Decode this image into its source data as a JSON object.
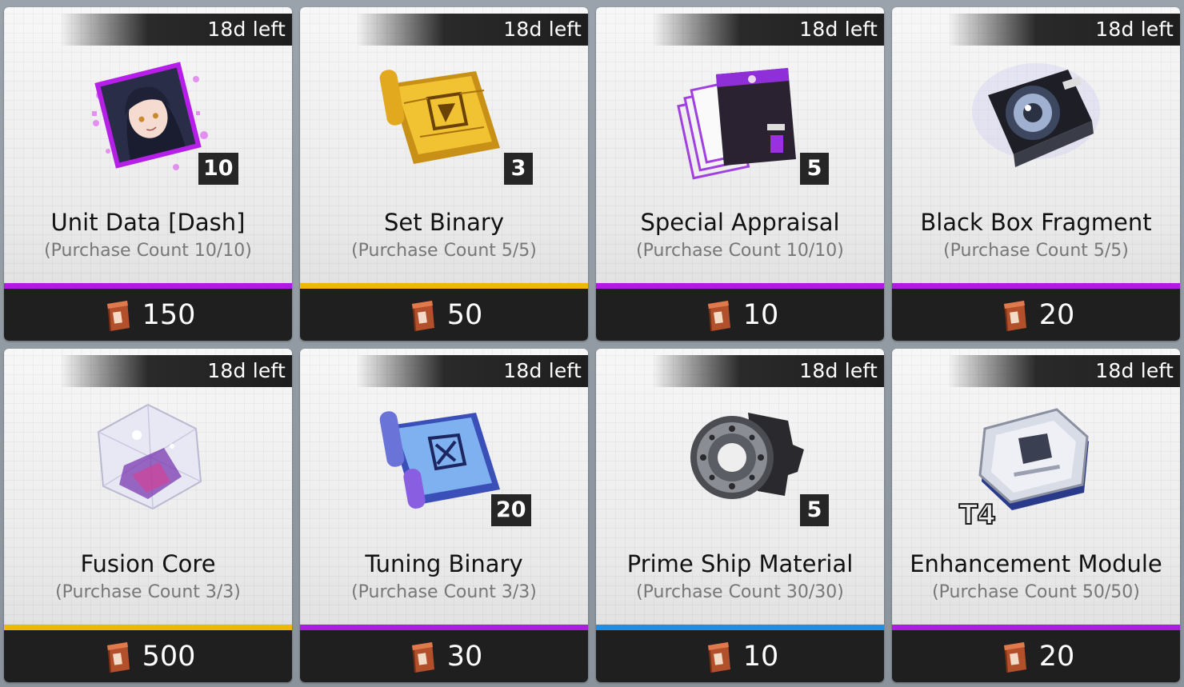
{
  "shop": {
    "items": [
      {
        "timer": "18d left",
        "name": "Unit Data [Dash]",
        "count": "(Purchase Count 10/10)",
        "qty": "10",
        "price": "150",
        "rarity_color": "#b01be0",
        "icon": "unit-data-icon"
      },
      {
        "timer": "18d left",
        "name": "Set Binary",
        "count": "(Purchase Count 5/5)",
        "qty": "3",
        "price": "50",
        "rarity_color": "#f2b705",
        "icon": "set-binary-icon"
      },
      {
        "timer": "18d left",
        "name": "Special Appraisal",
        "count": "(Purchase Count 10/10)",
        "qty": "5",
        "price": "10",
        "rarity_color": "#b01be0",
        "icon": "special-appraisal-icon"
      },
      {
        "timer": "18d left",
        "name": "Black Box Fragment",
        "count": "(Purchase Count 5/5)",
        "qty": "",
        "price": "20",
        "rarity_color": "#b01be0",
        "icon": "black-box-fragment-icon"
      },
      {
        "timer": "18d left",
        "name": "Fusion Core",
        "count": "(Purchase Count 3/3)",
        "qty": "",
        "price": "500",
        "rarity_color": "#f2b705",
        "icon": "fusion-core-icon"
      },
      {
        "timer": "18d left",
        "name": "Tuning Binary",
        "count": "(Purchase Count 3/3)",
        "qty": "20",
        "price": "30",
        "rarity_color": "#b01be0",
        "icon": "tuning-binary-icon"
      },
      {
        "timer": "18d left",
        "name": "Prime Ship Material",
        "count": "(Purchase Count 30/30)",
        "qty": "5",
        "price": "10",
        "rarity_color": "#1e8fe8",
        "icon": "prime-ship-material-icon"
      },
      {
        "timer": "18d left",
        "name": "Enhancement Module",
        "count": "(Purchase Count 50/50)",
        "qty": "",
        "tier": "T4",
        "price": "20",
        "rarity_color": "#b01be0",
        "icon": "enhancement-module-icon"
      }
    ],
    "currency_icon": "scrap-can-icon"
  }
}
